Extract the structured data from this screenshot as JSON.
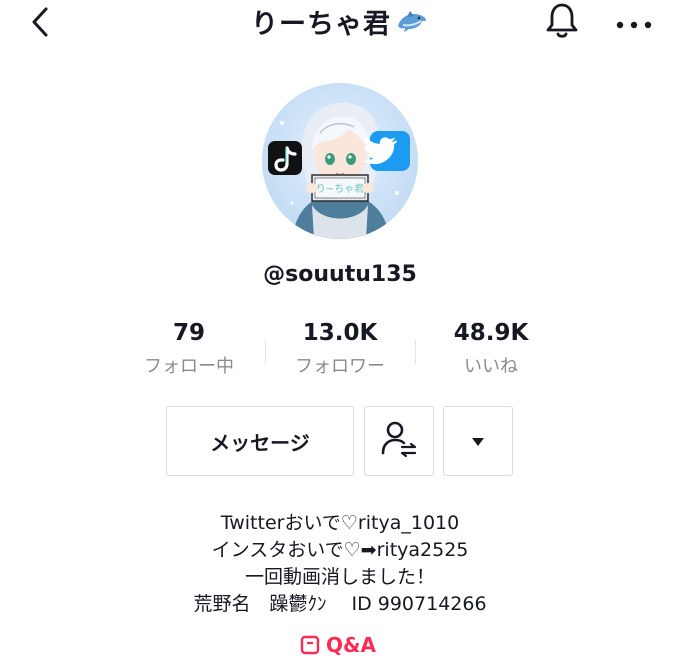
{
  "header": {
    "title": "りーちゃ君",
    "title_emoji_icon": "dolphin-icon",
    "back_icon": "chevron-left-icon",
    "bell_icon": "bell-icon",
    "more_icon": "more-dots-icon"
  },
  "profile": {
    "avatar_badge_text": "り~ちゃ君",
    "username": "@souutu135"
  },
  "stats": [
    {
      "value": "79",
      "label": "フォロー中"
    },
    {
      "value": "13.0K",
      "label": "フォロワー"
    },
    {
      "value": "48.9K",
      "label": "いいね"
    }
  ],
  "actions": {
    "message_label": "メッセージ",
    "follow_icon": "user-swap-icon",
    "dropdown_icon": "caret-down-icon"
  },
  "bio": [
    "Twitterおいで♡ritya_1010",
    "インスタおいで♡➡ritya2525",
    "一回動画消しました！",
    "荒野名　躁鬱ｸﾝ　 ID 990714266"
  ],
  "qa": {
    "label": "Q&A",
    "icon": "qa-icon"
  },
  "colors": {
    "accent": "#fe2c55",
    "text": "#161823",
    "muted": "#8a8b91",
    "border": "#dcdcdd"
  }
}
